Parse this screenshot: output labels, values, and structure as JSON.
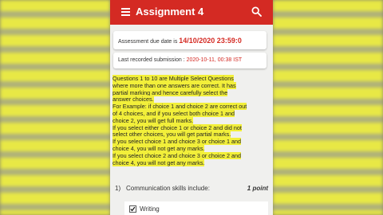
{
  "app": {
    "title": "Assignment 4"
  },
  "due": {
    "label": "Assessment due date is ",
    "value": "14/10/2020 23:59:0"
  },
  "submission": {
    "label": "Last recorded submission : ",
    "value": "2020-10-11, 00:38 IST"
  },
  "instructions": [
    "Questions 1 to 10 are Multiple Select Questions",
    "where more than one answers are correct. It has",
    "partial marking and hence carefully select the",
    "answer choices.",
    "For Example: if choice 1 and choice 2 are correct out",
    "of 4 choices, and if you select both choice 1 and",
    "choice 2, you will get full marks.",
    "If you select either choice 1 or choice 2 and did not",
    "select other choices, you will get partial marks.",
    "If you select choice 1 and choice 3 or choice 1 and",
    "choice 4, you will not get any marks.",
    "If you select choice 2 and choice 3 or choice 2 and",
    "choice 4, you will not get any marks."
  ],
  "question": {
    "number": "1)",
    "text": "Communication skills include:",
    "points": "1 point",
    "options": [
      {
        "label": "Writing",
        "checked": true
      }
    ]
  },
  "colors": {
    "app_bar": "#d42a23",
    "highlight": "#f2ef3a",
    "accent_text": "#d42a23"
  },
  "icons": {
    "menu": "hamburger-menu-icon",
    "search": "search-icon",
    "checkbox": "check-icon"
  }
}
